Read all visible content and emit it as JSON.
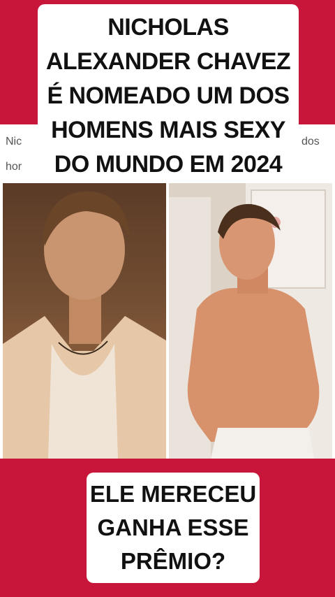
{
  "headline": {
    "lines": [
      "NICHOLAS",
      "ALEXANDER CHAVEZ",
      "É NOMEADO UM DOS",
      "HOMENS MAIS SEXY",
      "DO MUNDO EM 2024"
    ]
  },
  "background_article": {
    "left_fragments": [
      "Nic",
      "hor"
    ],
    "right_fragment": "dos"
  },
  "question": {
    "lines": [
      "ELE MERECEU",
      "GANHA ESSE",
      "PRÊMIO?"
    ]
  },
  "colors": {
    "background": "#c8163a",
    "panel": "#ffffff",
    "text": "#111111"
  }
}
